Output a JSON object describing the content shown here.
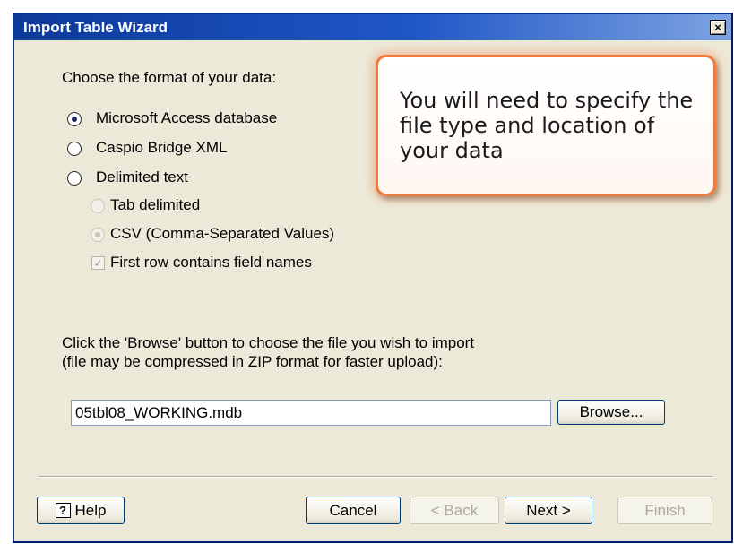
{
  "window": {
    "title": "Import Table Wizard",
    "close_label": "×"
  },
  "format_section": {
    "prompt": "Choose the format of your data:",
    "options": [
      {
        "label": "Microsoft Access database",
        "selected": true
      },
      {
        "label": "Caspio Bridge XML",
        "selected": false
      },
      {
        "label": "Delimited text",
        "selected": false
      }
    ],
    "delimited_suboptions": [
      {
        "label": "Tab delimited",
        "selected": false,
        "enabled": false
      },
      {
        "label": "CSV (Comma-Separated Values)",
        "selected": true,
        "enabled": false
      }
    ],
    "first_row_checkbox": {
      "label": "First row contains field names",
      "checked": true,
      "enabled": false
    }
  },
  "callout": {
    "text": "You will need to specify the file type and location of your data",
    "border_color": "#f07a3a"
  },
  "file_section": {
    "instruction_line1": "Click the 'Browse' button to choose the file you wish to import",
    "instruction_line2": "(file may be compressed in ZIP format for faster upload):",
    "file_value": "05tbl08_WORKING.mdb",
    "browse_label": "Browse..."
  },
  "footer": {
    "help_label": "Help",
    "help_icon": "question-mark-icon",
    "cancel_label": "Cancel",
    "back_label": "< Back",
    "next_label": "Next >",
    "finish_label": "Finish"
  }
}
